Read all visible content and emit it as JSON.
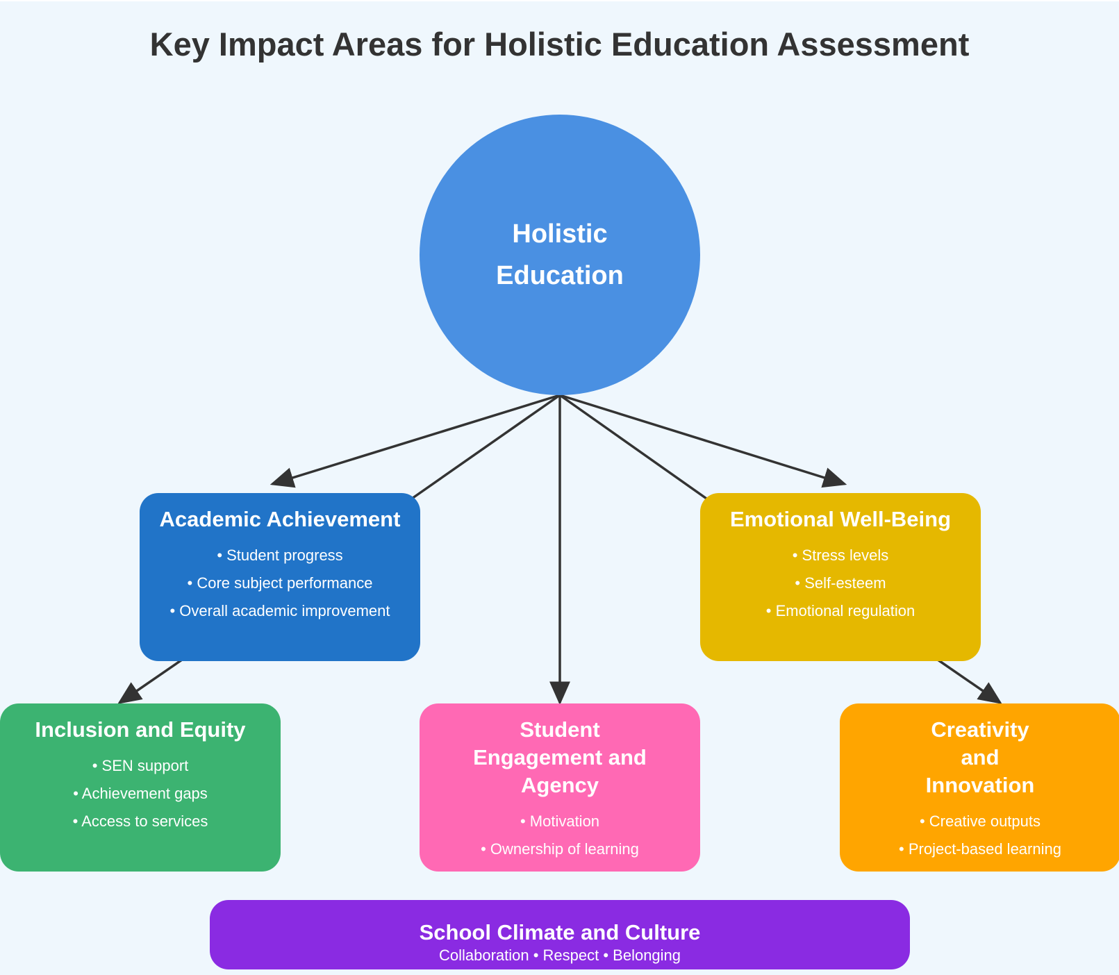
{
  "title": "Key Impact Areas for Holistic Education Assessment",
  "hub": {
    "line1": "Holistic",
    "line2": "Education",
    "color": "#4a90e2"
  },
  "areas": [
    {
      "title": "Academic Achievement",
      "color": "#2174c8",
      "items": [
        "• Student progress",
        "• Core subject performance",
        "• Overall academic improvement"
      ]
    },
    {
      "title": "Emotional Well-Being",
      "color": "#e5b800",
      "items": [
        "• Stress levels",
        "• Self-esteem",
        "• Emotional regulation"
      ]
    },
    {
      "title": "Inclusion and Equity",
      "color": "#3cb371",
      "items": [
        "• SEN support",
        "• Achievement gaps",
        "• Access to services"
      ]
    },
    {
      "title": "Student Engagement and Agency",
      "color": "#ff69b4",
      "items": [
        "• Motivation",
        "• Ownership of learning"
      ]
    },
    {
      "title": "Creativity and Innovation",
      "color": "#ffa500",
      "items": [
        "• Creative outputs",
        "• Project-based learning"
      ]
    }
  ],
  "climate": {
    "title": "School Climate and Culture",
    "subtitle": "Collaboration • Respect • Belonging",
    "color": "#8a2be2"
  },
  "edges": [
    {
      "from": "Holistic Education",
      "to": "Academic Achievement"
    },
    {
      "from": "Holistic Education",
      "to": "Emotional Well-Being"
    },
    {
      "from": "Holistic Education",
      "to": "Student Engagement and Agency"
    },
    {
      "from": "Academic Achievement",
      "to": "Inclusion and Equity"
    },
    {
      "from": "Emotional Well-Being",
      "to": "Creativity and Innovation"
    }
  ],
  "arrow_color": "#333333"
}
